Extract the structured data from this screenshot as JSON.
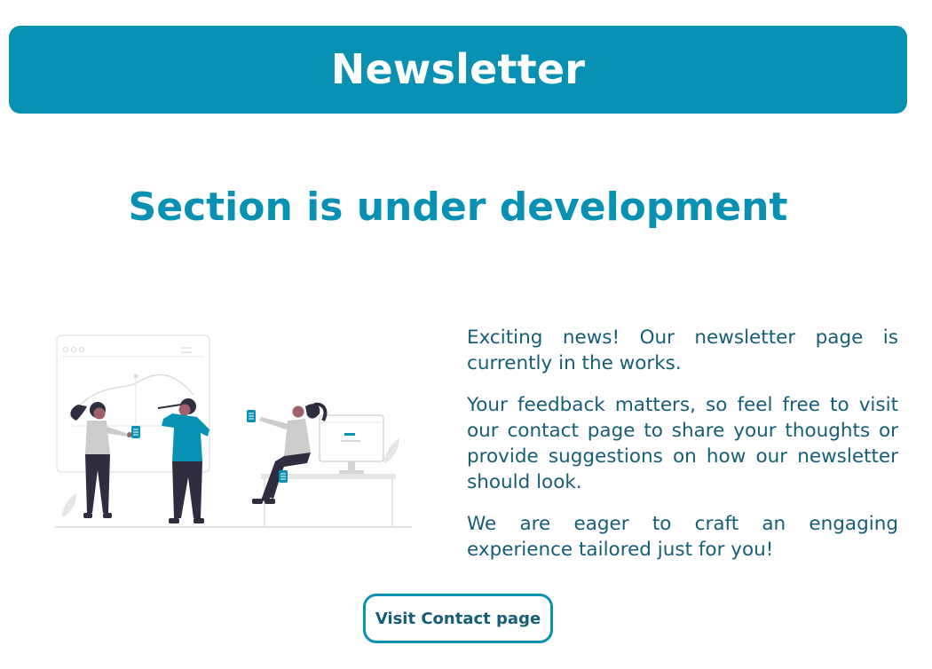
{
  "header": {
    "title": "Newsletter"
  },
  "main": {
    "heading": "Section is under development",
    "paragraphs": [
      "Exciting news! Our newsletter page is currently in the works.",
      "Your feedback matters, so feel free to visit our contact page to share your thoughts or provide suggestions on how our newsletter should look.",
      "We are eager to craft an engaging experience tailored just for you!"
    ],
    "cta_label": "Visit Contact page"
  },
  "colors": {
    "accent": "#0891b2",
    "text": "#155e75",
    "figure_dark": "#2f2e41",
    "figure_light": "#cccccc"
  }
}
